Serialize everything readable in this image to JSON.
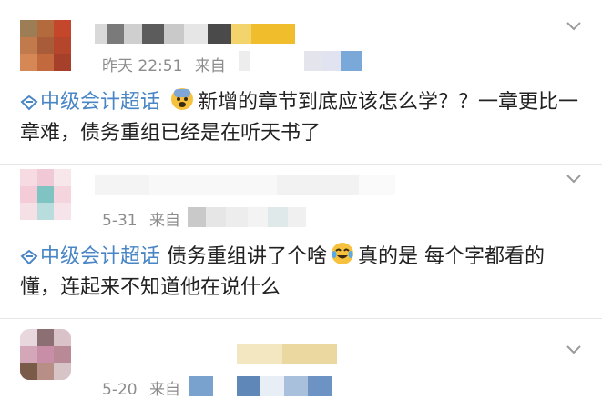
{
  "posts": [
    {
      "timestamp": "昨天 22:51",
      "source_label": "来自",
      "topic_label": "中级会计超话",
      "emoji_icon": "fearful-face-icon",
      "text": "新增的章节到底应该怎么学？？一章更比一章难，债务重组已经是在听天书了"
    },
    {
      "timestamp": "5-31",
      "source_label": "来自",
      "topic_label": "中级会计超话",
      "emoji_icon": "crying-laughing-face-icon",
      "text_before_emoji": "债务重组讲了个啥",
      "text_after_emoji": "真的是 每个字都看的懂，连起来不知道他在说什么"
    },
    {
      "timestamp": "5-20",
      "source_label": "来自"
    }
  ],
  "colors": {
    "topic_blue": "#4a86c5",
    "meta_gray": "#8c8c8c",
    "text_dark": "#222222"
  }
}
